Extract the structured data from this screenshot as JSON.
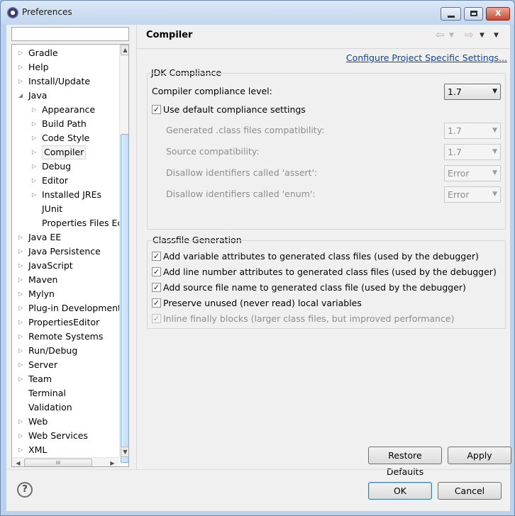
{
  "window": {
    "title": "Preferences",
    "minimize_glyph": "",
    "close_glyph": "x"
  },
  "filter": {
    "value": "",
    "placeholder": ""
  },
  "tree": {
    "items": [
      {
        "label": "Gradle",
        "expander": "right"
      },
      {
        "label": "Help",
        "expander": "right"
      },
      {
        "label": "Install/Update",
        "expander": "right"
      },
      {
        "label": "Java",
        "expander": "down"
      },
      {
        "label": "Appearance",
        "expander": "right"
      },
      {
        "label": "Build Path",
        "expander": "right"
      },
      {
        "label": "Code Style",
        "expander": "right"
      },
      {
        "label": "Compiler",
        "expander": "right",
        "selected": true
      },
      {
        "label": "Debug",
        "expander": "right"
      },
      {
        "label": "Editor",
        "expander": "right"
      },
      {
        "label": "Installed JREs",
        "expander": "right"
      },
      {
        "label": "JUnit",
        "expander": "none"
      },
      {
        "label": "Properties Files Ed",
        "expander": "none"
      },
      {
        "label": "Java EE",
        "expander": "right"
      },
      {
        "label": "Java Persistence",
        "expander": "right"
      },
      {
        "label": "JavaScript",
        "expander": "right"
      },
      {
        "label": "Maven",
        "expander": "right"
      },
      {
        "label": "Mylyn",
        "expander": "right"
      },
      {
        "label": "Plug-in Development",
        "expander": "right"
      },
      {
        "label": "PropertiesEditor",
        "expander": "right"
      },
      {
        "label": "Remote Systems",
        "expander": "right"
      },
      {
        "label": "Run/Debug",
        "expander": "right"
      },
      {
        "label": "Server",
        "expander": "right"
      },
      {
        "label": "Team",
        "expander": "right"
      },
      {
        "label": "Terminal",
        "expander": "none"
      },
      {
        "label": "Validation",
        "expander": "none"
      },
      {
        "label": "Web",
        "expander": "right"
      },
      {
        "label": "Web Services",
        "expander": "right"
      },
      {
        "label": "XML",
        "expander": "right"
      }
    ],
    "hscroll_grip": "III"
  },
  "page": {
    "title": "Compiler",
    "configure_link": "Configure Project Specific Settings...",
    "jdk_compliance": {
      "group_label": "JDK Compliance",
      "compliance_level_label": "Compiler compliance level:",
      "compliance_level_value": "1.7",
      "use_default_label": "Use default compliance settings",
      "use_default_checked": true,
      "rows": [
        {
          "label": "Generated .class files compatibility:",
          "value": "1.7"
        },
        {
          "label": "Source compatibility:",
          "value": "1.7"
        },
        {
          "label": "Disallow identifiers called 'assert':",
          "value": "Error"
        },
        {
          "label": "Disallow identifiers called 'enum':",
          "value": "Error"
        }
      ]
    },
    "classfile_generation": {
      "group_label": "Classfile Generation",
      "options": [
        {
          "label": "Add variable attributes to generated class files (used by the debugger)",
          "checked": true,
          "enabled": true
        },
        {
          "label": "Add line number attributes to generated class files (used by the debugger)",
          "checked": true,
          "enabled": true
        },
        {
          "label": "Add source file name to generated class file (used by the debugger)",
          "checked": true,
          "enabled": true
        },
        {
          "label": "Preserve unused (never read) local variables",
          "checked": true,
          "enabled": true
        },
        {
          "label": "Inline finally blocks (larger class files, but improved performance)",
          "checked": true,
          "enabled": false
        }
      ]
    },
    "restore_defaults_label": "Restore Defaults",
    "apply_label": "Apply"
  },
  "footer": {
    "help_glyph": "?",
    "ok_label": "OK",
    "cancel_label": "Cancel"
  },
  "icons": {
    "app": "eclipse-icon",
    "back": "back-arrow-icon",
    "forward": "forward-arrow-icon",
    "menu": "view-menu-icon",
    "help": "help-icon",
    "check": "check-icon"
  },
  "colors": {
    "link": "#0645ad",
    "scroll_thumb": "#bfdaf6",
    "default_button_border": "#3c7fb1"
  }
}
